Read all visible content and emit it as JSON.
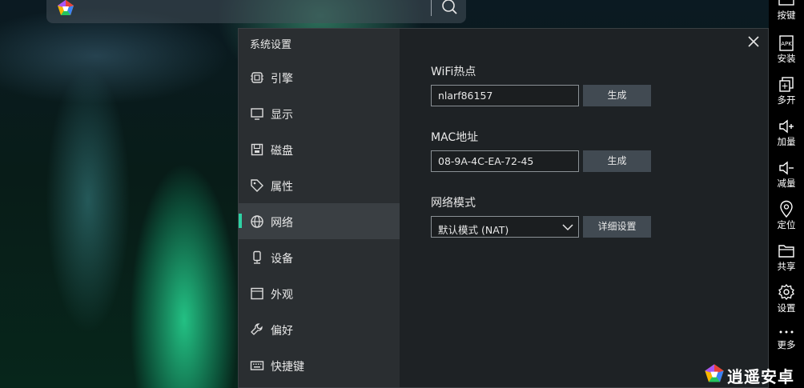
{
  "search": {
    "value": ""
  },
  "dialog": {
    "title": "系统设置",
    "nav": [
      {
        "label": "引擎",
        "icon": "chip-icon"
      },
      {
        "label": "显示",
        "icon": "monitor-icon"
      },
      {
        "label": "磁盘",
        "icon": "disk-icon"
      },
      {
        "label": "属性",
        "icon": "tag-icon"
      },
      {
        "label": "网络",
        "icon": "globe-icon",
        "active": true
      },
      {
        "label": "设备",
        "icon": "device-icon"
      },
      {
        "label": "外观",
        "icon": "window-icon"
      },
      {
        "label": "偏好",
        "icon": "wrench-icon"
      },
      {
        "label": "快捷键",
        "icon": "keyboard-icon"
      }
    ],
    "wifi": {
      "title": "WiFi热点",
      "value": "nlarf86157",
      "button": "生成"
    },
    "mac": {
      "title": "MAC地址",
      "value": "08-9A-4C-EA-72-45",
      "button": "生成"
    },
    "network_mode": {
      "title": "网络模式",
      "selected": "默认模式 (NAT)",
      "button": "详细设置"
    }
  },
  "toolbar": [
    {
      "label": "按键",
      "icon": "keymap-icon"
    },
    {
      "label": "安装",
      "icon": "apk-icon"
    },
    {
      "label": "多开",
      "icon": "multi-instance-icon"
    },
    {
      "label": "加量",
      "icon": "volume-up-icon"
    },
    {
      "label": "减量",
      "icon": "volume-down-icon"
    },
    {
      "label": "定位",
      "icon": "location-icon"
    },
    {
      "label": "共享",
      "icon": "folder-icon"
    },
    {
      "label": "设置",
      "icon": "gear-icon"
    },
    {
      "label": "更多",
      "icon": "more-icon"
    }
  ],
  "watermark": {
    "text": "逍遥安卓"
  },
  "colors": {
    "accent": "#2ed2a4",
    "panel": "#1e2225",
    "sidebar": "#2a2e31",
    "button": "#414a52"
  }
}
